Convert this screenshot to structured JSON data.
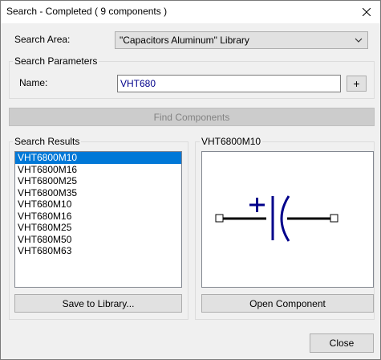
{
  "window": {
    "title": "Search - Completed  ( 9 components )"
  },
  "search_area": {
    "label": "Search Area:",
    "selected_value": "\"Capacitors Aluminum\" Library"
  },
  "search_parameters": {
    "group_title": "Search Parameters",
    "name_label": "Name:",
    "name_value": "VHT680",
    "add_label": "+"
  },
  "find_button": {
    "label": "Find Components"
  },
  "results": {
    "group_title": "Search Results",
    "items": [
      "VHT6800M10",
      "VHT6800M16",
      "VHT6800M25",
      "VHT6800M35",
      "VHT680M10",
      "VHT680M16",
      "VHT680M25",
      "VHT680M50",
      "VHT680M63"
    ],
    "selected_index": 0,
    "save_label": "Save to Library..."
  },
  "preview": {
    "title": "VHT6800M10",
    "open_label": "Open Component",
    "symbol_color": "#00008b"
  },
  "footer": {
    "close_label": "Close"
  }
}
